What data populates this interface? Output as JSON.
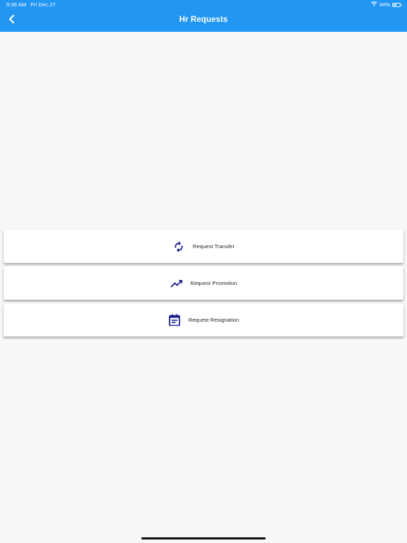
{
  "status_bar": {
    "time": "9:38 AM",
    "date": "Fri Dec 27",
    "battery": "44%",
    "icons": [
      "wifi-icon",
      "battery-icon"
    ]
  },
  "header": {
    "title": "Hr Requests",
    "back_icon": "chevron-left-icon"
  },
  "requests": [
    {
      "label": "Request Transfer",
      "icon": "sync-icon"
    },
    {
      "label": "Request Promotion",
      "icon": "trending-up-icon"
    },
    {
      "label": "Request Resignation",
      "icon": "calendar-note-icon"
    }
  ],
  "colors": {
    "appbar": "#2196f3",
    "icon": "#1a1f8f",
    "background": "#f7f7f7"
  }
}
